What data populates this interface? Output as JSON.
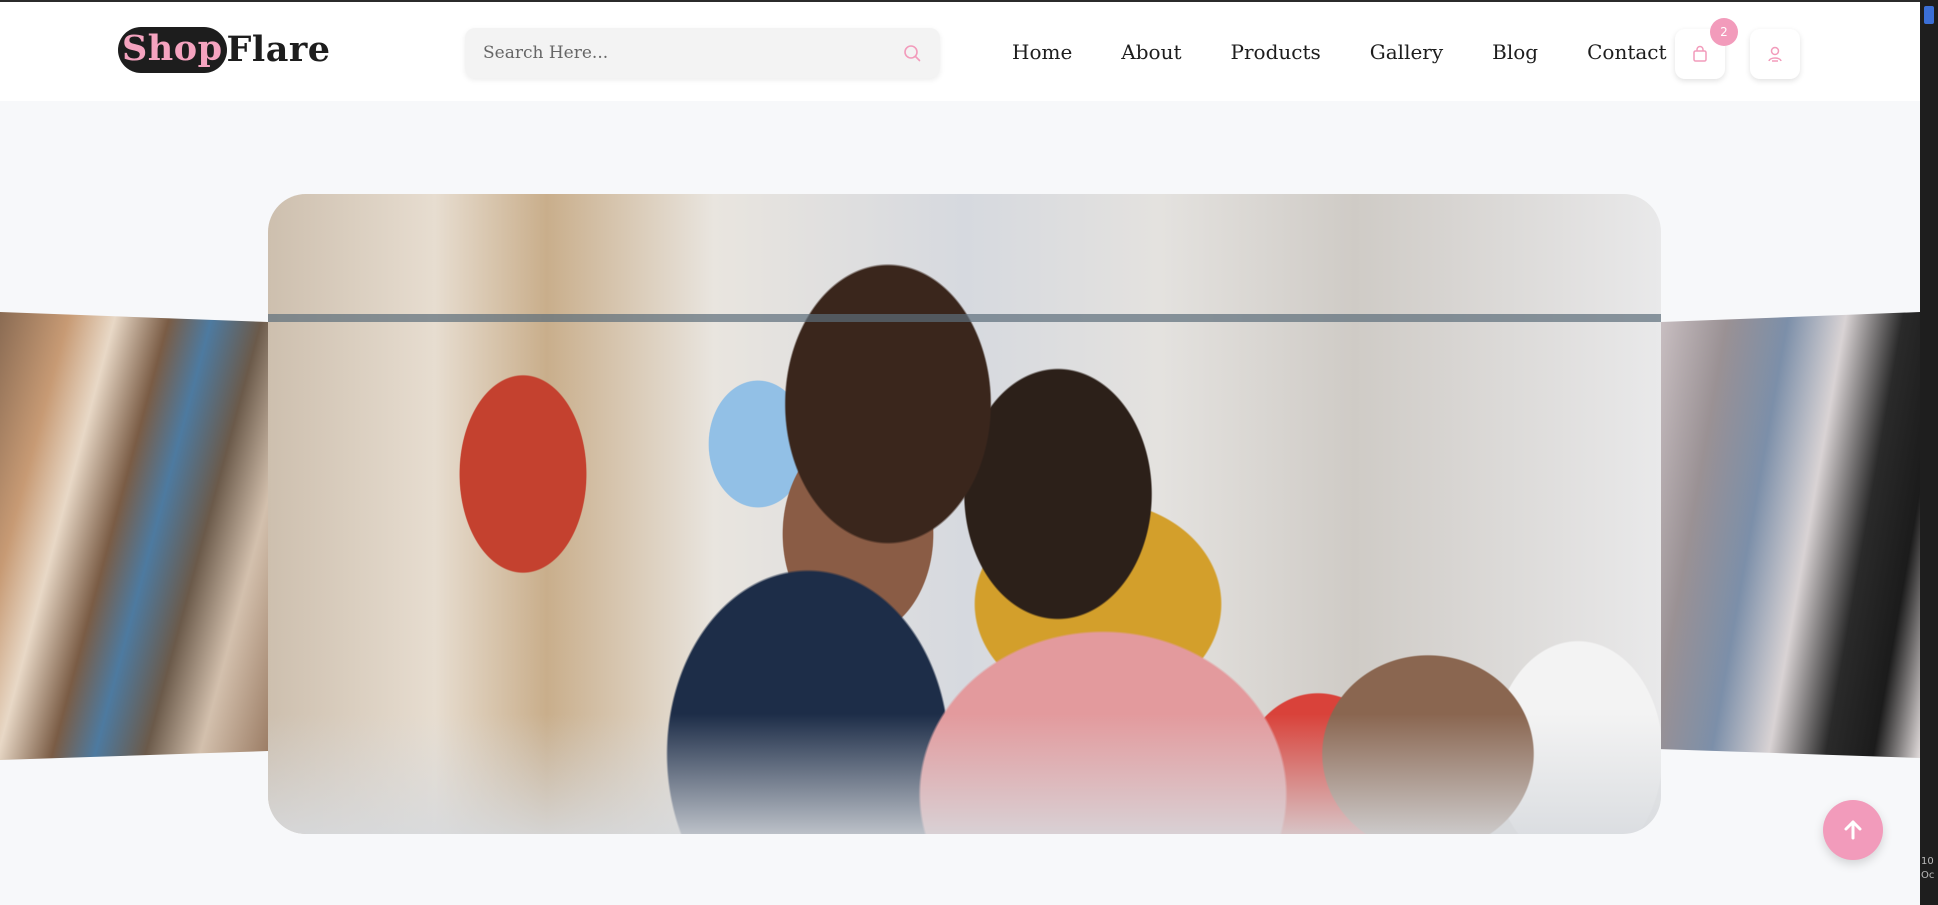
{
  "brand": {
    "part1": "Shop",
    "part2": "Flare"
  },
  "search": {
    "placeholder": "Search Here..."
  },
  "nav": {
    "items": [
      {
        "label": "Home"
      },
      {
        "label": "About"
      },
      {
        "label": "Products"
      },
      {
        "label": "Gallery"
      },
      {
        "label": "Blog"
      },
      {
        "label": "Contact"
      }
    ]
  },
  "cart": {
    "count": "2",
    "icon": "shopping-bag-icon"
  },
  "user": {
    "icon": "user-icon"
  },
  "hero": {
    "slides": [
      {
        "description": "Women shopping for clothes in a boutique"
      },
      {
        "description": "Two women holding a pink sweater in a clothing store"
      },
      {
        "description": "Clothing store interior with mannequins"
      }
    ]
  },
  "scroll_top": {
    "icon": "arrow-up-icon"
  },
  "colors": {
    "accent": "#f29bbb",
    "dark": "#1d1d1d",
    "background": "#f7f8fa"
  },
  "devtools_note": {
    "line1": "10",
    "line2": "Oc"
  }
}
